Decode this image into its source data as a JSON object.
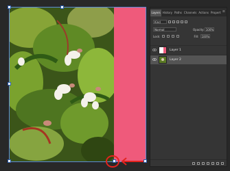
{
  "panel": {
    "tabs": [
      "Layers",
      "History",
      "Paths",
      "Channels",
      "Actions",
      "Propert"
    ],
    "active_tab": "Layers",
    "filter_kind": "Kind",
    "blend_mode": "Normal",
    "opacity_label": "Opacity:",
    "opacity_value": "100%",
    "lock_label": "Lock:",
    "fill_label": "Fill:",
    "fill_value": "100%"
  },
  "layers": [
    {
      "name": "Layer 1",
      "selected": false
    },
    {
      "name": "Layer 2",
      "selected": true
    }
  ],
  "colors": {
    "pink_layer": "#ef5a7b",
    "selection_border": "#5b8bd9",
    "annotation_red": "#e3231e",
    "panel_bg": "#353535",
    "workspace_bg": "#282828"
  }
}
